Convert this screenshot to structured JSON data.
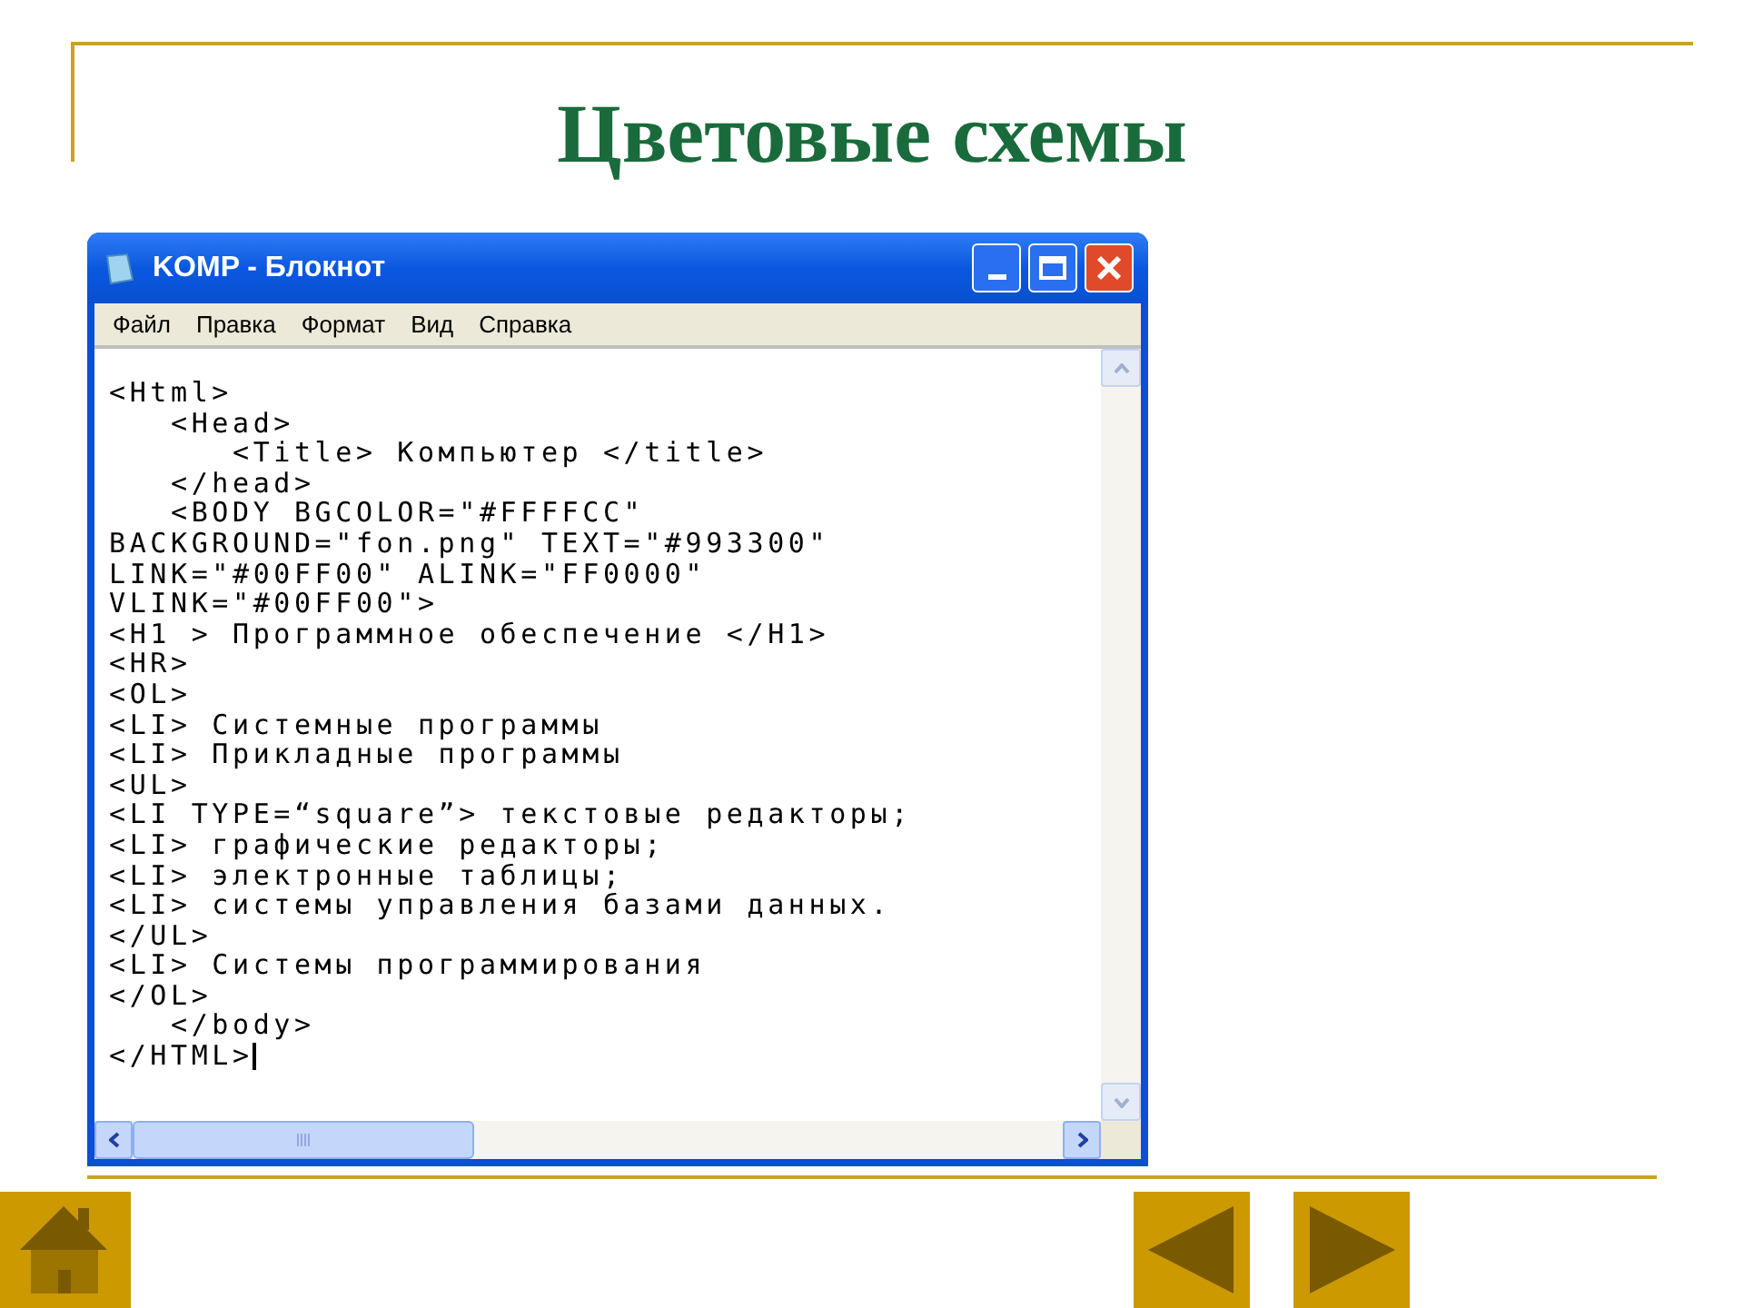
{
  "slide_title": "Цветовые схемы",
  "window": {
    "title": "KOMP - Блокнот",
    "menu": [
      "Файл",
      "Правка",
      "Формат",
      "Вид",
      "Справка"
    ],
    "lines": [
      "<Html>",
      "   <Head>",
      "      <Title> Компьютер </title>",
      "   </head>",
      "   <BODY BGCOLOR=\"#FFFFCC\"",
      "BACKGROUND=\"fon.png\" TEXT=\"#993300\"",
      "LINK=\"#00FF00\" ALINK=\"FF0000\"",
      "VLINK=\"#00FF00\">",
      "<H1 > Программное обеспечение </H1>",
      "<HR>",
      "<OL>",
      "<LI> Системные программы",
      "<LI> Прикладные программы",
      "<UL>",
      "<LI TYPE=“square”> текстовые редакторы;",
      "<LI> графические редакторы;",
      "<LI> электронные таблицы;",
      "<LI> системы управления базами данных.",
      "</UL>",
      "<LI> Системы программирования",
      "</OL>",
      "   </body>",
      "</HTML>"
    ]
  }
}
